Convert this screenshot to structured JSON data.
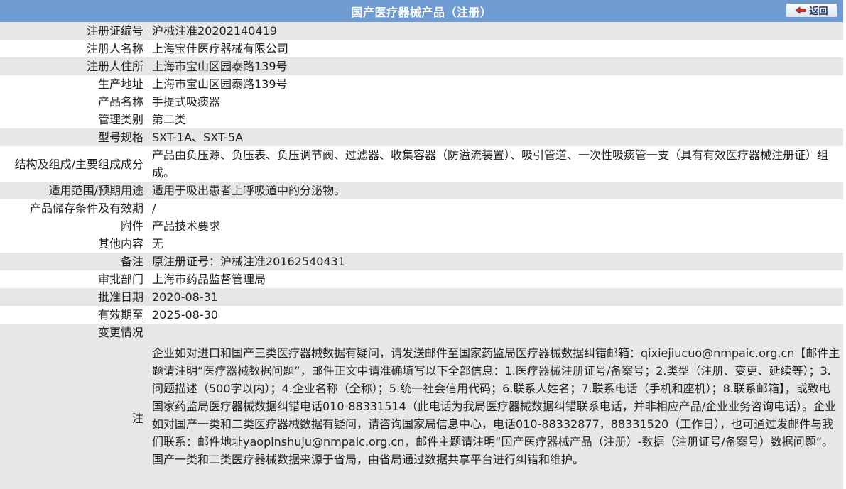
{
  "header": {
    "title": "国产医疗器械产品（注册）",
    "back_label": "返回"
  },
  "rows": [
    {
      "label": "注册证编号",
      "value": "沪械注准20202140419"
    },
    {
      "label": "注册人名称",
      "value": "上海宝佳医疗器械有限公司"
    },
    {
      "label": "注册人住所",
      "value": "上海市宝山区园泰路139号"
    },
    {
      "label": "生产地址",
      "value": "上海市宝山区园泰路139号"
    },
    {
      "label": "产品名称",
      "value": "手提式吸痰器"
    },
    {
      "label": "管理类别",
      "value": "第二类"
    },
    {
      "label": "型号规格",
      "value": "SXT-1A、SXT-5A"
    },
    {
      "label": "结构及组成/主要组成成分",
      "value": "产品由负压源、负压表、负压调节阀、过滤器、收集容器（防溢流装置）、吸引管道、一次性吸痰管一支（具有有效医疗器械注册证）组成。"
    },
    {
      "label": "适用范围/预期用途",
      "value": "适用于吸出患者上呼吸道中的分泌物。"
    },
    {
      "label": "产品储存条件及有效期",
      "value": "/"
    },
    {
      "label": "附件",
      "value": "产品技术要求"
    },
    {
      "label": "其他内容",
      "value": "无"
    },
    {
      "label": "备注",
      "value": "原注册证号：沪械注准20162540431"
    },
    {
      "label": "审批部门",
      "value": "上海市药品监督管理局"
    },
    {
      "label": "批准日期",
      "value": "2020-08-31"
    },
    {
      "label": "有效期至",
      "value": "2025-08-30"
    },
    {
      "label": "变更情况",
      "value": ""
    },
    {
      "label": "注",
      "value": "企业如对进口和国产三类医疗器械数据有疑问，请发送邮件至国家药监局医疗器械数据纠错邮箱：qixiejiucuo@nmpaic.org.cn【邮件主题请注明“医疗器械数据问题”，邮件正文中请准确填写以下全部信息：1.医疗器械注册证号/备案号；2.类型（注册、变更、延续等）；3.问题描述（500字以内）；4.企业名称（全称）；5.统一社会信用代码；6.联系人姓名；7.联系电话（手机和座机）；8.联系邮箱】，或致电国家药监局医疗器械数据纠错电话010-88331514（此电话为我局医疗器械数据纠错联系电话，并非相应产品/企业业务咨询电话）。企业如对国产一类和二类医疗器械数据有疑问，请咨询国家局信息中心，电话010-88332877，88331520（工作日），也可通过发邮件与我们联系：邮件地址yaopinshuju@nmpaic.org.cn，邮件主题请注明“国产医疗器械产品（注册）-数据（注册证号/备案号）数据问题”。国产一类和二类医疗器械数据来源于省局，由省局通过数据共享平台进行纠错和维护。"
    }
  ],
  "colors": {
    "header_bg": "#6d9bd2",
    "stripe_bg": "#e7e7e7",
    "text": "#222222"
  },
  "icons": {
    "back": "back-arrow-icon"
  }
}
